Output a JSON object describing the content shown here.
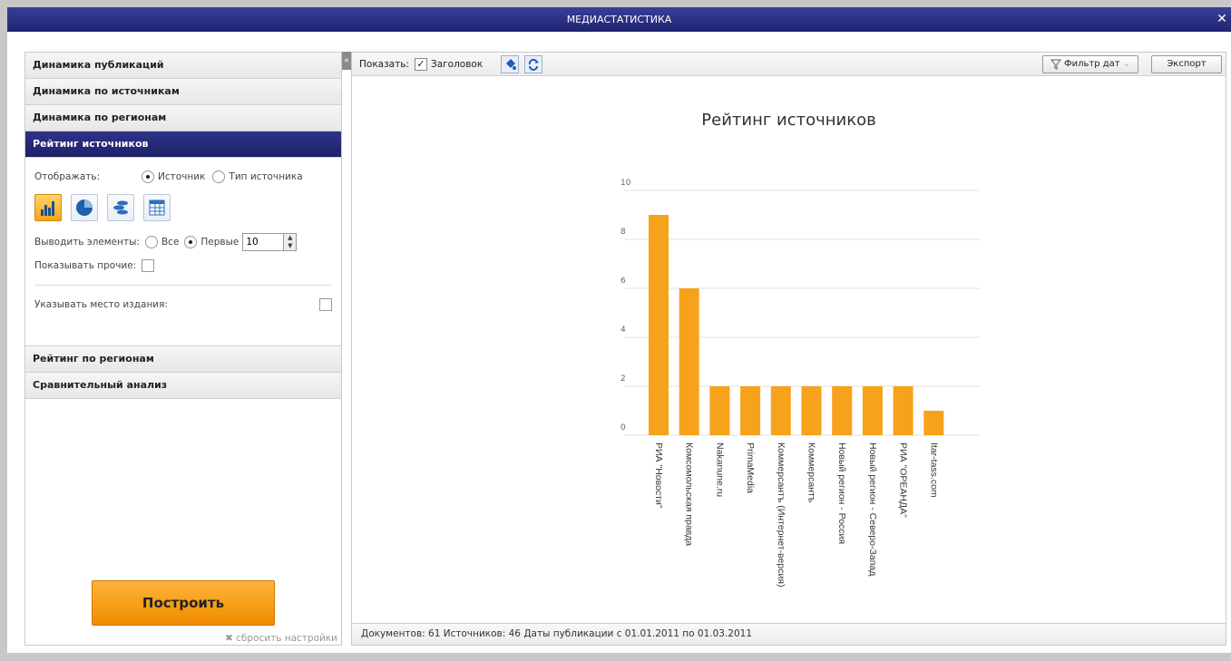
{
  "window": {
    "title": "МЕДИАСТАТИСТИКА",
    "close_glyph": "✕"
  },
  "sidebar": {
    "sections_top": [
      {
        "label": "Динамика публикаций"
      },
      {
        "label": "Динамика по источникам"
      },
      {
        "label": "Динамика по регионам"
      }
    ],
    "active_section": {
      "label": "Рейтинг источников"
    },
    "panel": {
      "display_label": "Отображать:",
      "display_options": [
        "Источник",
        "Тип источника"
      ],
      "display_selected": "Источник",
      "chart_type_icons": [
        "bar-chart-icon",
        "pie-chart-icon",
        "bubble-chart-icon",
        "table-icon"
      ],
      "chart_type_selected": "bar-chart-icon",
      "output_label": "Выводить элементы:",
      "output_options": [
        "Все",
        "Первые"
      ],
      "output_selected": "Первые",
      "output_count": "10",
      "show_others_label": "Показывать прочие:",
      "show_others_checked": false,
      "publication_place_label": "Указывать место издания:",
      "publication_place_checked": false
    },
    "sections_bottom": [
      {
        "label": "Рейтинг по регионам"
      },
      {
        "label": "Сравнительный анализ"
      }
    ],
    "build_button": "Построить",
    "reset_link": "сбросить настройки"
  },
  "toolbar": {
    "show_label": "Показать:",
    "header_checkbox_label": "Заголовок",
    "header_checked": true,
    "date_filter_button": "Фильтр дат",
    "export_button": "Экспорт",
    "collapse_glyph": "«"
  },
  "status": "Документов: 61  Источников: 46  Даты публикации с 01.01.2011 по 01.03.2011",
  "colors": {
    "accent": "#f7a21b",
    "header_blue": "#25297a"
  },
  "chart_data": {
    "type": "bar",
    "title": "Рейтинг источников",
    "categories": [
      "РИА \"Новости\"",
      "Комсомольская правда",
      "Nakanune.ru",
      "PrimaMedia",
      "Коммерсантъ (Интернет-версия)",
      "Коммерсантъ",
      "Новый регион - Россия",
      "Новый регион - Северо-Запад",
      "РИА \"ОРЕАНДА\"",
      "Itar-tass.com"
    ],
    "values": [
      9,
      6,
      2,
      2,
      2,
      2,
      2,
      2,
      2,
      1
    ],
    "ylim": [
      0,
      10
    ],
    "yticks": [
      0,
      2,
      4,
      6,
      8,
      10
    ],
    "grid": true,
    "color": "#f7a21b"
  }
}
